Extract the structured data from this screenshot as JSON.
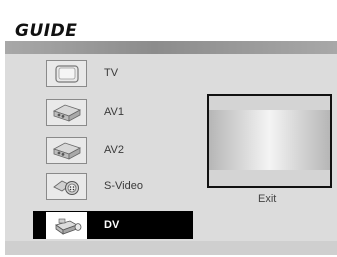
{
  "header": {
    "title": "GUIDE"
  },
  "menu": {
    "items": [
      {
        "label": "TV",
        "icon": "tv-icon"
      },
      {
        "label": "AV1",
        "icon": "vcr-icon"
      },
      {
        "label": "AV2",
        "icon": "vcr-icon"
      },
      {
        "label": "S-Video",
        "icon": "svideo-connector-icon"
      },
      {
        "label": "DV",
        "icon": "camcorder-icon",
        "selected": true
      }
    ]
  },
  "preview": {
    "exit_label": "Exit"
  },
  "colors": {
    "selection": "#000000",
    "stripe": "#8c8c8c",
    "screen": "#dcdcdc"
  }
}
